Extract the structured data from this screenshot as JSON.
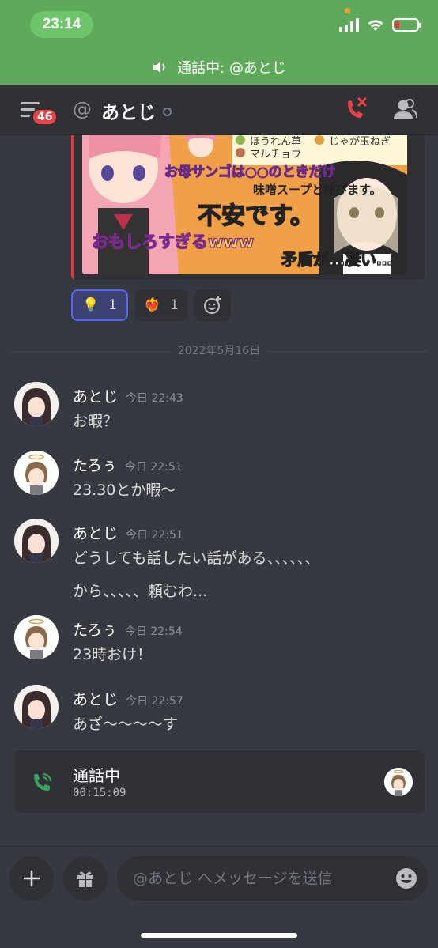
{
  "status_bar": {
    "time": "23:14"
  },
  "call_banner": {
    "text": "通話中: @あとじ"
  },
  "header": {
    "badge_count": "46",
    "at_symbol": "@",
    "channel_name": "あとじ"
  },
  "embed": {
    "image_texts": {
      "top_left": "ほうれん草",
      "top_right": "じゃが玉ねぎ",
      "mid": "マルチョウ",
      "caption1": "お母サンゴは○○のときだけ",
      "caption2": "味噌スープと呼びます。",
      "caption3": "不安です。",
      "caption4": "おもしろすぎるwww",
      "caption5": "矛盾が…凄い…"
    }
  },
  "reactions": [
    {
      "emoji": "💡",
      "count": "1",
      "active": true
    },
    {
      "emoji": "❤️‍🔥",
      "count": "1",
      "active": false
    }
  ],
  "date_divider": "2022年5月16日",
  "messages": [
    {
      "user": "あとじ",
      "time": "今日 22:43",
      "lines": [
        "お暇？"
      ]
    },
    {
      "user": "たろぅ",
      "time": "今日 22:51",
      "lines": [
        "23.30とか暇〜"
      ]
    },
    {
      "user": "あとじ",
      "time": "今日 22:51",
      "lines": [
        "どうしても話したい話がある、、、、、、",
        "から、、、、、頼むわ..."
      ]
    },
    {
      "user": "たろぅ",
      "time": "今日 22:54",
      "lines": [
        "23時おけ！"
      ]
    },
    {
      "user": "あとじ",
      "time": "今日 22:57",
      "lines": [
        "あざ〜〜〜〜す"
      ]
    }
  ],
  "call_card": {
    "title": "通話中",
    "duration": "00:15:09"
  },
  "composer": {
    "placeholder": "@あとじ へメッセージを送信"
  },
  "colors": {
    "call_green": "#5ea95a",
    "accent": "#5865f2",
    "danger": "#ed4245"
  }
}
